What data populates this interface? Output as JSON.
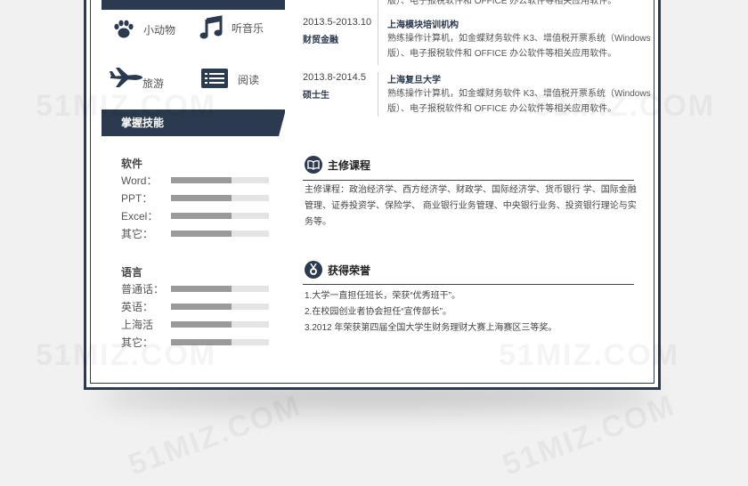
{
  "hobbies": [
    {
      "label": "小动物",
      "icon": "paw-icon"
    },
    {
      "label": "听音乐",
      "icon": "music-note-icon"
    },
    {
      "label": "旅游",
      "icon": "airplane-icon"
    },
    {
      "label": "阅读",
      "icon": "book-list-icon"
    }
  ],
  "skills": {
    "section_title": "掌握技能",
    "software": {
      "title": "软件",
      "items": [
        {
          "label": "Word：",
          "level": 0.62
        },
        {
          "label": "PPT：",
          "level": 0.62
        },
        {
          "label": "Excel：",
          "level": 0.62
        },
        {
          "label": "其它：",
          "level": 0.62
        }
      ]
    },
    "language": {
      "title": "语言",
      "items": [
        {
          "label": "普通话：",
          "level": 0.62
        },
        {
          "label": "英语：",
          "level": 0.62
        },
        {
          "label": "上海活",
          "level": 0.62
        },
        {
          "label": "其它：",
          "level": 0.62
        }
      ]
    }
  },
  "education": {
    "first_desc_tail": "版）、电子报税软件和 OFFICE 办公软件等相关应用软件。",
    "items": [
      {
        "date": "2013.5-2013.10",
        "major": "财贸金融",
        "school": "上海模块培训机构",
        "desc": "熟练操作计算机，如金蝶财务软件 K3、增值税开票系统（Windows版）、电子报税软件和 OFFICE 办公软件等相关应用软件。"
      },
      {
        "date": "2013.8-2014.5",
        "major": "硕士生",
        "school": "上海复旦大学",
        "desc": "熟练操作计算机，如金蝶财务软件 K3、增值税开票系统（Windows版）、电子报税软件和 OFFICE 办公软件等相关应用软件。"
      }
    ]
  },
  "courses": {
    "title": "主修课程",
    "text": "主修课程：政治经济学、西方经济学、财政学、国际经济学、货币银行 学、国际金融管理、证券投资学、保险学、 商业银行业务管理、中央银行业务、投资银行理论与实务等。"
  },
  "honors": {
    "title": "获得荣誉",
    "items": [
      "1.大学一直担任班长，荣获“优秀班干”。",
      "2.在校园创业者协会担任“宣传部长”。",
      "3.2012 年荣获第四届全国大学生财务理财大赛上海赛区三等奖。"
    ]
  },
  "watermark": "51MIZ.COM",
  "colors": {
    "navy": "#2b3a4e",
    "bar_fill": "#9a9a9a",
    "bar_track": "#e4e4e4"
  }
}
